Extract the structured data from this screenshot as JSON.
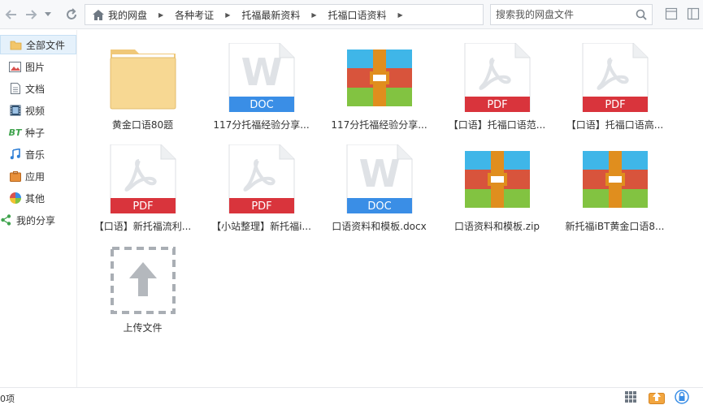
{
  "toolbar": {
    "breadcrumb": [
      "我的网盘",
      "各种考证",
      "托福最新资料",
      "托福口语资料"
    ],
    "search_placeholder": "搜索我的网盘文件"
  },
  "sidebar": {
    "items": [
      {
        "label": "全部文件",
        "icon": "folder-icon",
        "active": true
      },
      {
        "label": "图片",
        "icon": "image-icon"
      },
      {
        "label": "文档",
        "icon": "document-icon"
      },
      {
        "label": "视频",
        "icon": "video-icon"
      },
      {
        "label": "种子",
        "icon": "torrent-icon"
      },
      {
        "label": "音乐",
        "icon": "music-icon"
      },
      {
        "label": "应用",
        "icon": "app-icon"
      },
      {
        "label": "其他",
        "icon": "other-icon"
      },
      {
        "label": "我的分享",
        "icon": "share-icon"
      }
    ]
  },
  "files": [
    {
      "name": "黄金口语80题",
      "type": "folder"
    },
    {
      "name": "117分托福经验分享...",
      "type": "doc",
      "badge": "DOC"
    },
    {
      "name": "117分托福经验分享...",
      "type": "zip"
    },
    {
      "name": "【口语】托福口语范...",
      "type": "pdf",
      "badge": "PDF"
    },
    {
      "name": "【口语】托福口语高...",
      "type": "pdf",
      "badge": "PDF"
    },
    {
      "name": "【口语】新托福流利...",
      "type": "pdf",
      "badge": "PDF"
    },
    {
      "name": "【小站整理】新托福i...",
      "type": "pdf",
      "badge": "PDF"
    },
    {
      "name": "口语资料和模板.docx",
      "type": "doc",
      "badge": "DOC"
    },
    {
      "name": "口语资料和模板.zip",
      "type": "zip"
    },
    {
      "name": "新托福iBT黄金口语8...",
      "type": "zip"
    },
    {
      "name": "上传文件",
      "type": "upload"
    }
  ],
  "status": {
    "count": "0项"
  },
  "colors": {
    "pdf": "#d9343c",
    "doc": "#3a8ee6",
    "folder": "#f7d893",
    "zip_blue": "#3fb6e8",
    "zip_red": "#d8543c",
    "zip_green": "#82c341",
    "zip_band": "#e08e1e",
    "accent": "#3a8ee6"
  }
}
